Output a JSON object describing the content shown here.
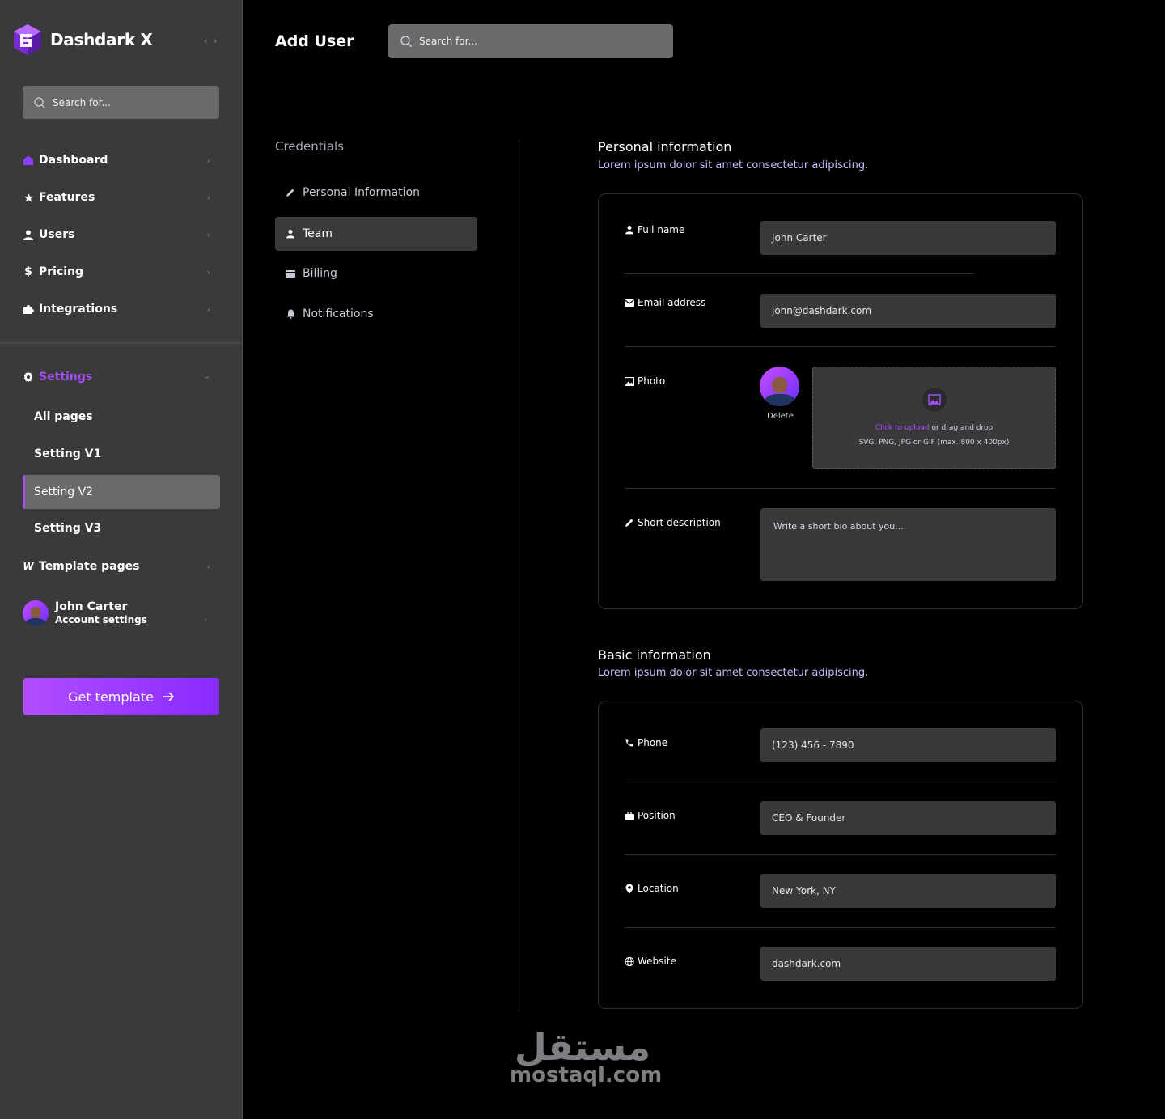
{
  "sidebar": {
    "brand": "Dashdark X",
    "collapse": "‹ ›",
    "search_placeholder": "Search for...",
    "nav": [
      {
        "label": "Dashboard",
        "icon": "home-icon"
      },
      {
        "label": "Features",
        "icon": "star-icon"
      },
      {
        "label": "Users",
        "icon": "user-icon"
      },
      {
        "label": "Pricing",
        "icon": "dollar-icon"
      },
      {
        "label": "Integrations",
        "icon": "puzzle-icon"
      }
    ],
    "settings": {
      "label": "Settings",
      "children": [
        "All pages",
        "Setting V1",
        "Setting V2",
        "Setting V3"
      ],
      "active": "Setting V2"
    },
    "template_pages": "Template pages",
    "account": {
      "name": "John Carter",
      "subtitle": "Account settings"
    },
    "cta": "Get template"
  },
  "header": {
    "title": "Add User",
    "search_placeholder": "Search for..."
  },
  "credentials": {
    "title": "Credentials",
    "items": [
      {
        "label": "Personal Information",
        "icon": "pencil-icon"
      },
      {
        "label": "Team",
        "icon": "user-icon",
        "active": true
      },
      {
        "label": "Billing",
        "icon": "card-icon"
      },
      {
        "label": "Notifications",
        "icon": "bell-icon"
      }
    ]
  },
  "personal": {
    "title": "Personal information",
    "subtitle": "Lorem ipsum dolor sit amet consectetur adipiscing.",
    "full_name_label": "Full name",
    "full_name": "John Carter",
    "email_label": "Email address",
    "email": "john@dashdark.com",
    "photo_label": "Photo",
    "photo_delete": "Delete",
    "upload_link": "Click to upload",
    "upload_text": " or drag and drop",
    "upload_hint": "SVG, PNG, JPG or GIF (max. 800 x 400px)",
    "desc_label": "Short description",
    "desc_placeholder": "Write a short bio about you..."
  },
  "basic": {
    "title": "Basic information",
    "subtitle": "Lorem ipsum dolor sit amet consectetur adipiscing.",
    "fields": [
      {
        "label": "Phone",
        "value": "(123) 456 - 7890",
        "icon": "phone-icon"
      },
      {
        "label": "Position",
        "value": "CEO & Founder",
        "icon": "briefcase-icon"
      },
      {
        "label": "Location",
        "value": "New York, NY",
        "icon": "pin-icon"
      },
      {
        "label": "Website",
        "value": "dashdark.com",
        "icon": "globe-icon"
      }
    ]
  },
  "watermark": {
    "arabic": "مستقل",
    "latin": "mostaql.com"
  },
  "colors": {
    "accent": "#a64dff",
    "sidebar": "#3a3a3c",
    "input": "#39393b"
  }
}
